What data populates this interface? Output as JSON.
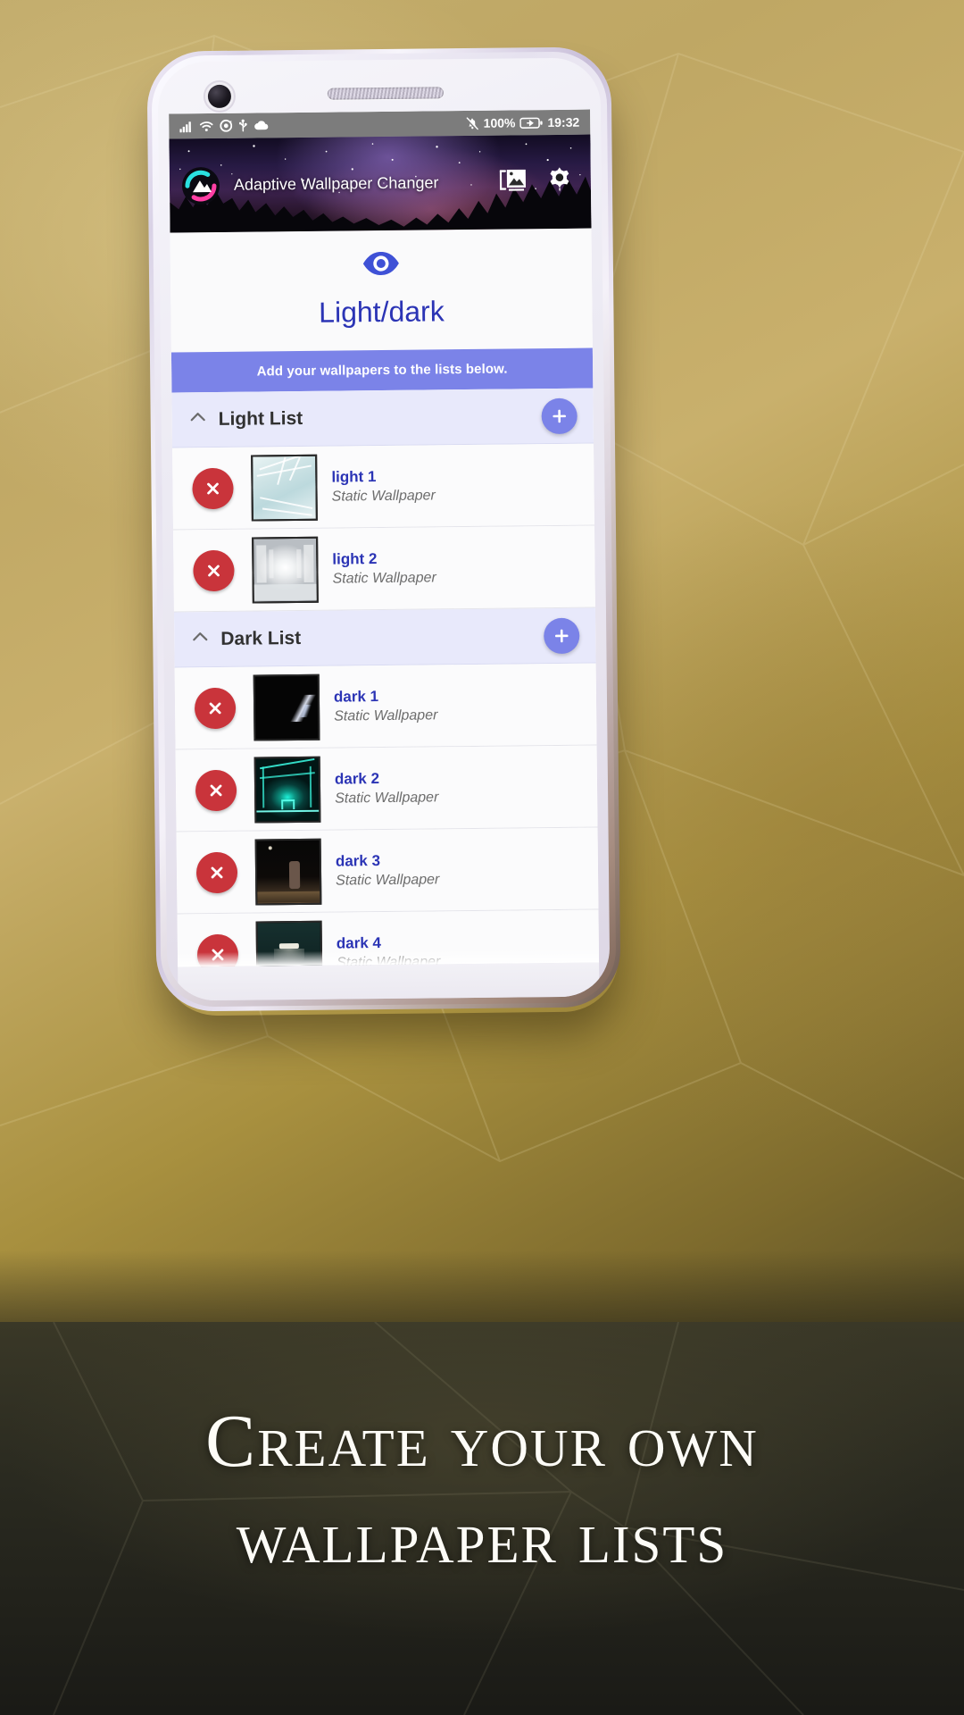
{
  "promo": {
    "caption_line1": "Create your own",
    "caption_line2": "wallpaper lists"
  },
  "statusbar": {
    "signal_icon": "signal-bars-icon",
    "wifi_icon": "wifi-icon",
    "sync_icon": "sync-icon",
    "usb_icon": "usb-icon",
    "cloud_icon": "cloud-icon",
    "mute_icon": "bell-muted-icon",
    "battery_percent": "100%",
    "battery_icon": "battery-charging-icon",
    "time": "19:32"
  },
  "appbar": {
    "logo_icon": "app-logo-icon",
    "title": "Adaptive Wallpaper Changer",
    "gallery_icon": "photo-library-icon",
    "settings_icon": "gear-icon"
  },
  "hero": {
    "icon": "eye-icon",
    "title": "Light/dark"
  },
  "banner": {
    "text": "Add your wallpapers to the lists below."
  },
  "colors": {
    "accent_blue": "#2b34b5",
    "periwinkle": "#7b83e8",
    "banner_bg": "#7b83e8",
    "section_bg": "#e8e9fb",
    "delete_red": "#c9343b",
    "statusbar_gray": "#7c7c7c"
  },
  "sections": [
    {
      "title": "Light List",
      "collapse_icon": "chevron-up-icon",
      "add_icon": "plus-icon",
      "items": [
        {
          "title": "light 1",
          "subtitle": "Static Wallpaper",
          "thumb": "t-light1",
          "delete_icon": "close-circle-icon"
        },
        {
          "title": "light 2",
          "subtitle": "Static Wallpaper",
          "thumb": "t-light2",
          "delete_icon": "close-circle-icon"
        }
      ]
    },
    {
      "title": "Dark List",
      "collapse_icon": "chevron-up-icon",
      "add_icon": "plus-icon",
      "items": [
        {
          "title": "dark 1",
          "subtitle": "Static Wallpaper",
          "thumb": "t-dark1",
          "delete_icon": "close-circle-icon"
        },
        {
          "title": "dark 2",
          "subtitle": "Static Wallpaper",
          "thumb": "t-dark2",
          "delete_icon": "close-circle-icon"
        },
        {
          "title": "dark 3",
          "subtitle": "Static Wallpaper",
          "thumb": "t-dark3",
          "delete_icon": "close-circle-icon"
        },
        {
          "title": "dark 4",
          "subtitle": "Static Wallpaper",
          "thumb": "t-dark4",
          "delete_icon": "close-circle-icon"
        }
      ]
    }
  ]
}
